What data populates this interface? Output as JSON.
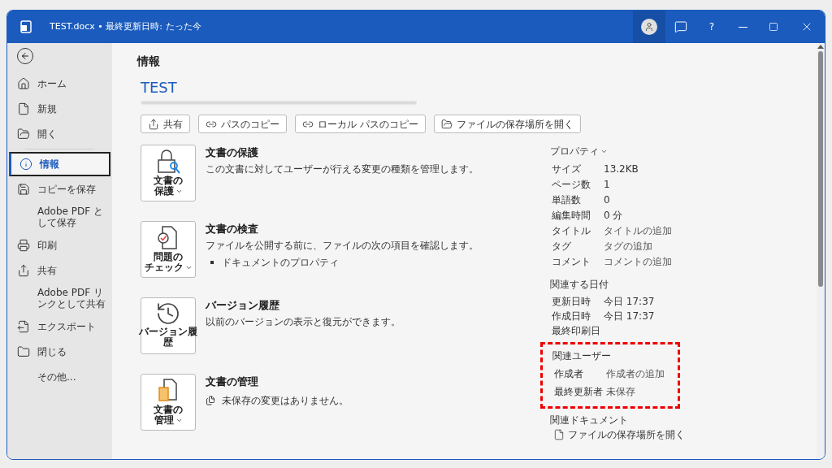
{
  "title_bar": {
    "title": "TEST.docx • 最終更新日時: たった今",
    "help": "?"
  },
  "sidebar": {
    "items": [
      {
        "label": "ホーム",
        "selected": false
      },
      {
        "label": "新規",
        "selected": false
      },
      {
        "label": "開く",
        "selected": false
      },
      {
        "label": "情報",
        "selected": true
      },
      {
        "label": "コピーを保存",
        "selected": false
      },
      {
        "label": "Adobe PDF として保存",
        "selected": false
      },
      {
        "label": "印刷",
        "selected": false
      },
      {
        "label": "共有",
        "selected": false
      },
      {
        "label": "Adobe PDF リンクとして共有",
        "selected": false
      },
      {
        "label": "エクスポート",
        "selected": false
      },
      {
        "label": "閉じる",
        "selected": false
      },
      {
        "label": "その他...",
        "selected": false
      }
    ]
  },
  "main": {
    "heading": "情報",
    "document_title": "TEST",
    "action_buttons": [
      "共有",
      "パスのコピー",
      "ローカル パスのコピー",
      "ファイルの保存場所を開く"
    ],
    "sections": [
      {
        "button_lines": [
          "文書の",
          "保護"
        ],
        "dropdown": true,
        "title": "文書の保護",
        "description": "この文書に対してユーザーが行える変更の種類を管理します。"
      },
      {
        "button_lines": [
          "問題の",
          "チェック"
        ],
        "dropdown": true,
        "title": "文書の検査",
        "description": "ファイルを公開する前に、ファイルの次の項目を確認します。",
        "bullets": [
          "ドキュメントのプロパティ"
        ]
      },
      {
        "button_lines": [
          "バージョン履",
          "歴"
        ],
        "dropdown": false,
        "title": "バージョン履歴",
        "description": "以前のバージョンの表示と復元ができます。"
      },
      {
        "button_lines": [
          "文書の",
          "管理"
        ],
        "dropdown": true,
        "title": "文書の管理",
        "note": "未保存の変更はありません。"
      }
    ]
  },
  "properties": {
    "heading": "プロパティ",
    "rows": [
      {
        "label": "サイズ",
        "value": "13.2KB"
      },
      {
        "label": "ページ数",
        "value": "1"
      },
      {
        "label": "単語数",
        "value": "0"
      },
      {
        "label": "編集時間",
        "value": "0 分"
      },
      {
        "label": "タイトル",
        "value": "タイトルの追加"
      },
      {
        "label": "タグ",
        "value": "タグの追加"
      },
      {
        "label": "コメント",
        "value": "コメントの追加"
      }
    ],
    "dates": {
      "heading": "関連する日付",
      "rows": [
        {
          "label": "更新日時",
          "value": "今日 17:37"
        },
        {
          "label": "作成日時",
          "value": "今日 17:37"
        },
        {
          "label": "最終印刷日"
        }
      ]
    },
    "users": {
      "heading": "関連ユーザー",
      "highlighted": true,
      "rows": [
        {
          "label": "作成者",
          "value": "作成者の追加"
        },
        {
          "label": "最終更新者",
          "value": "未保存"
        }
      ]
    },
    "documents": {
      "heading": "関連ドキュメント",
      "link": "ファイルの保存場所を開く"
    }
  }
}
